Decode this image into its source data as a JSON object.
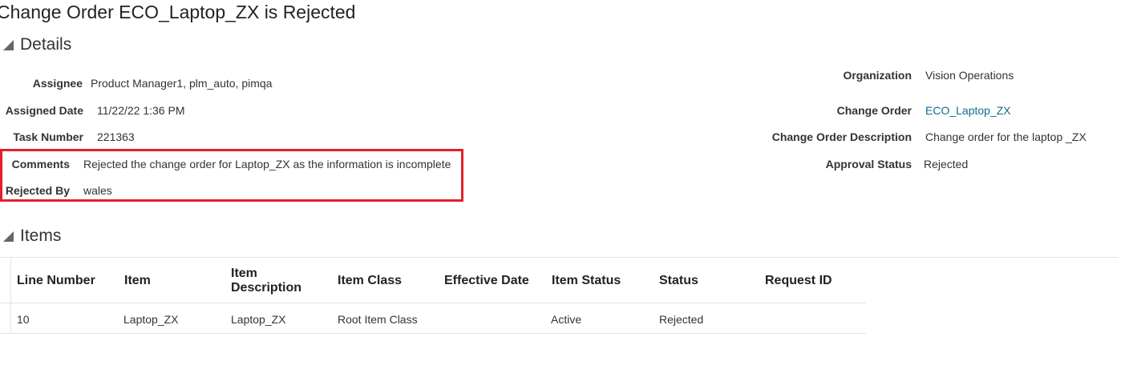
{
  "page": {
    "title": "Change Order ECO_Laptop_ZX is Rejected"
  },
  "details": {
    "header": "Details",
    "left": [
      {
        "label": "Assignee",
        "value": "Product Manager1, plm_auto, pimqa"
      },
      {
        "label": "Assigned Date",
        "value": "11/22/22 1:36 PM"
      },
      {
        "label": "Task Number",
        "value": "221363"
      },
      {
        "label": "Comments",
        "value": "Rejected the change order for Laptop_ZX as the information is incomplete"
      },
      {
        "label": "Rejected By",
        "value": "wales"
      }
    ],
    "right": [
      {
        "label": "Organization",
        "value": "Vision Operations"
      },
      {
        "label": "Change Order",
        "value": "ECO_Laptop_ZX"
      },
      {
        "label": "Change Order Description",
        "value": "Change order for the laptop _ZX"
      },
      {
        "label": "Approval Status",
        "value": "Rejected"
      }
    ],
    "highlight_color": "#e3202a",
    "link_color": "#0e6d92"
  },
  "items": {
    "header": "Items",
    "columns": [
      "Line Number",
      "Item",
      "Item Description",
      "Item Class",
      "Effective Date",
      "Item Status",
      "Status",
      "Request ID"
    ],
    "rows": [
      [
        "10",
        "Laptop_ZX",
        "Laptop_ZX",
        "Root Item Class",
        "",
        "Active",
        "Rejected",
        ""
      ]
    ]
  }
}
